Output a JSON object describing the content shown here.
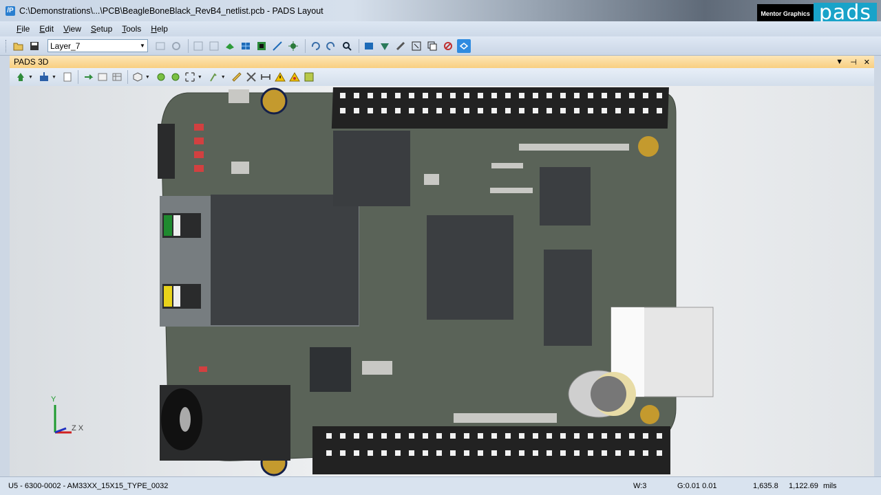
{
  "window": {
    "title": "C:\\Demonstrations\\...\\PCB\\BeagleBoneBlack_RevB4_netlist.pcb - PADS Layout",
    "app_icon": "pads-app-icon",
    "brand_company": "Mentor Graphics",
    "brand_product": "pads"
  },
  "menu": {
    "items": [
      {
        "label": "File",
        "underline": "F",
        "rest": "ile"
      },
      {
        "label": "Edit",
        "underline": "E",
        "rest": "dit"
      },
      {
        "label": "View",
        "underline": "V",
        "rest": "iew"
      },
      {
        "label": "Setup",
        "underline": "S",
        "rest": "etup"
      },
      {
        "label": "Tools",
        "underline": "T",
        "rest": "ools"
      },
      {
        "label": "Help",
        "underline": "H",
        "rest": "elp"
      }
    ]
  },
  "toolbar": {
    "layer_value": "Layer_7",
    "icons": [
      "open-icon",
      "save-icon",
      "properties-icon",
      "refresh-icon",
      "zoom-in-icon",
      "zoom-out-icon",
      "route-icon",
      "grid-icon",
      "board-icon",
      "wire-icon",
      "spark-icon",
      "undo-icon",
      "redo-icon",
      "search-icon",
      "view-icon",
      "design-icon",
      "tool-icon",
      "select-icon",
      "copy-icon",
      "drc-icon",
      "pads3d-icon"
    ]
  },
  "panel": {
    "title": "PADS 3D",
    "controls": [
      "dropdown-icon",
      "pin-icon",
      "close-icon"
    ]
  },
  "status": {
    "component": "U5 - 6300-0002 - AM33XX_15X15_TYPE_0032",
    "width": "W:3",
    "grid": "G:0.01 0.01",
    "x": "1,635.8",
    "y": "1,122.69",
    "units": "mils"
  },
  "axis": {
    "y": "Y",
    "x": "Z X"
  }
}
